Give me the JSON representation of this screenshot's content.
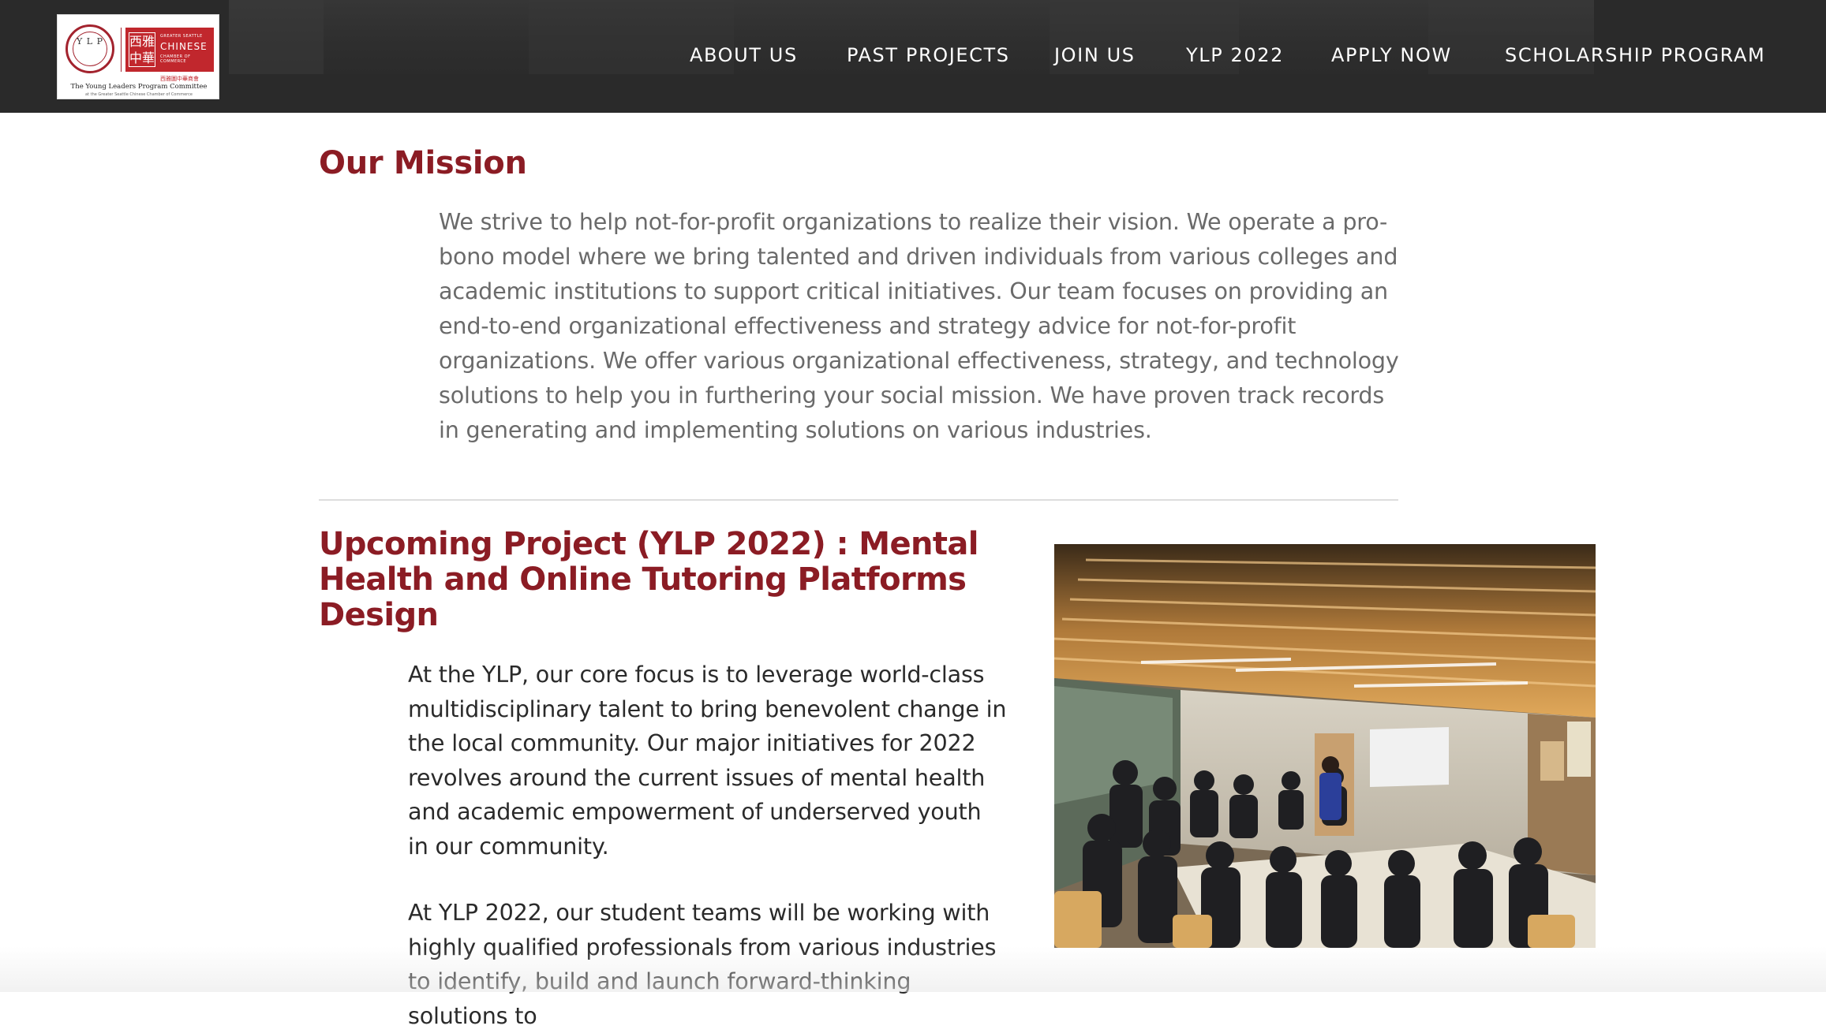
{
  "logo": {
    "circle_letters": "Y L P",
    "chamber_top": "GREATER SEATTLE",
    "chamber_word": "CHINESE",
    "chamber_bottom": "CHAMBER OF COMMERCE",
    "chamber_glyphs": "西雅\n中華",
    "chamber_cn": "西雅圖中華商會",
    "caption": "The Young Leaders Program Committee",
    "subcaption": "at the Greater Seattle Chinese Chamber of Commerce"
  },
  "nav": {
    "items": [
      {
        "label": "ABOUT US"
      },
      {
        "label": "PAST PROJECTS"
      },
      {
        "label": "JOIN US"
      },
      {
        "label": "YLP 2022"
      },
      {
        "label": "APPLY NOW"
      },
      {
        "label": "SCHOLARSHIP PROGRAM"
      }
    ]
  },
  "mission": {
    "title": "Our Mission",
    "body": "We strive to help not-for-profit organizations to realize their vision. We operate a pro-bono model where we bring talented and driven individuals from various colleges and academic institutions to support critical initiatives. Our team focuses on providing an end-to-end organizational effectiveness and strategy advice for not-for-profit organizations. We offer various organizational effectiveness, strategy, and technology solutions to help you in furthering your social mission. We have proven track records in generating and implementing solutions on various industries."
  },
  "project": {
    "title": "Upcoming Project (YLP 2022) : Mental Health and Online Tutoring Platforms Design",
    "paragraph1": "At the YLP, our core focus is to leverage world-class multidisciplinary talent to bring benevolent change in the local community. Our major initiatives for 2022 revolves around the current issues of mental health and academic empowerment of underserved youth in our community.",
    "paragraph2": "At YLP 2022, our student teams will be working with highly qualified professionals from various industries to identify, build and launch forward-thinking solutions to"
  },
  "colors": {
    "header_bg": "#2a2a2a",
    "heading": "#8b1c24",
    "mission_text": "#6a6a6a",
    "body_text": "#2a2a2a",
    "brand_red": "#c1272d"
  }
}
